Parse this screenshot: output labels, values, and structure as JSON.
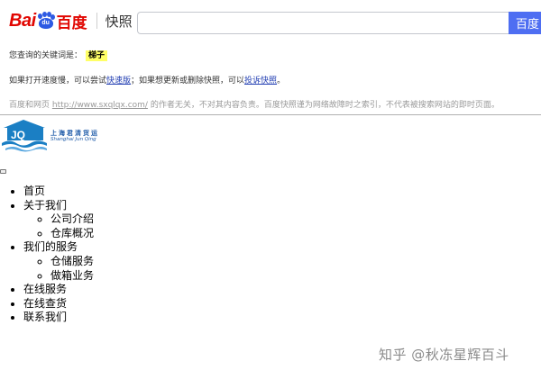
{
  "snapshot_header": {
    "logo_bai": "Bai",
    "logo_du": "du",
    "logo_baidu_cn": "百度",
    "logo_kuaizhao": "快照",
    "search_value": "",
    "search_button": "百度"
  },
  "notice": {
    "keyword_prefix": "您查询的关键词是：",
    "keyword": "梯子",
    "line2_a": "如果打开速度慢，可以尝试",
    "fast_link": "快速版",
    "line2_b": "；如果想更新或删除快照，可以",
    "complaint_link": "投诉快照",
    "line2_c": "。",
    "line3_a": "百度和网页 ",
    "site_url": "http://www.sxqlqx.com/",
    "line3_b": " 的作者无关，不对其内容负责。百度快照谨为网络故障时之索引，不代表被搜索网站的即时页面。"
  },
  "site": {
    "logo_letters": "JQ",
    "logo_cn": "上海君清货运",
    "logo_en": "Shanghai Jun Qing",
    "nav": {
      "home": "首页",
      "about": "关于我们",
      "about_children": [
        "公司介绍",
        "仓库概况"
      ],
      "services": "我们的服务",
      "services_children": [
        "仓储服务",
        "做箱业务"
      ],
      "online_service": "在线服务",
      "online_query": "在线查货",
      "contact": "联系我们"
    }
  },
  "watermark": "知乎 @秋冻星辉百斗",
  "colors": {
    "baidu_red": "#e10601",
    "baidu_blue": "#2d5ae3",
    "button_blue": "#4e6ef2",
    "link_blue": "#2440b3",
    "keyword_highlight": "#ffff66",
    "site_brand_blue": "#1d5aa8"
  }
}
